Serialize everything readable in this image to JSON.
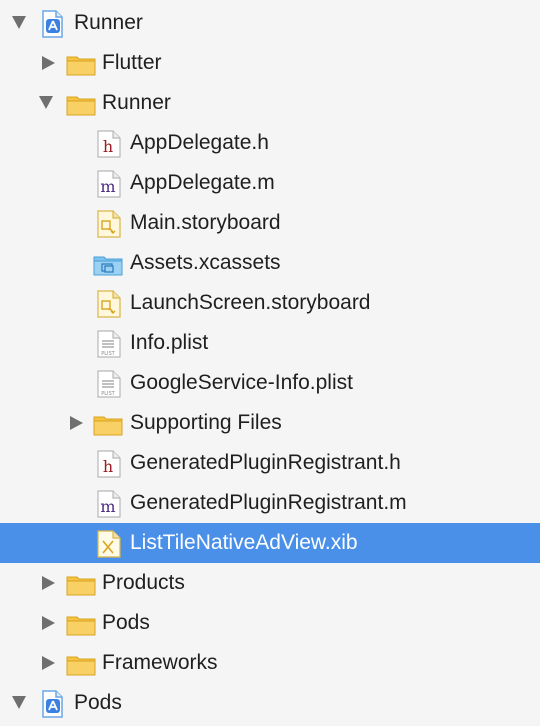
{
  "colors": {
    "background": "#f5f5f5",
    "selection": "#4a90e8",
    "folder": "#f5c242",
    "folder_blue": "#7cc3f0",
    "header_file": "#9b1c22",
    "impl_file": "#4b2a83"
  },
  "tree": [
    {
      "label": "Runner",
      "icon": "xcode-project-icon",
      "disclosure": "expanded"
    },
    {
      "label": "Flutter",
      "icon": "folder-icon",
      "disclosure": "collapsed"
    },
    {
      "label": "Runner",
      "icon": "folder-icon",
      "disclosure": "expanded"
    },
    {
      "label": "AppDelegate.h",
      "icon": "header-file-icon",
      "icon_glyph": "h"
    },
    {
      "label": "AppDelegate.m",
      "icon": "implementation-file-icon",
      "icon_glyph": "m"
    },
    {
      "label": "Main.storyboard",
      "icon": "storyboard-file-icon"
    },
    {
      "label": "Assets.xcassets",
      "icon": "asset-catalog-icon"
    },
    {
      "label": "LaunchScreen.storyboard",
      "icon": "storyboard-file-icon"
    },
    {
      "label": "Info.plist",
      "icon": "plist-file-icon",
      "icon_glyph": "PLIST"
    },
    {
      "label": "GoogleService-Info.plist",
      "icon": "plist-file-icon",
      "icon_glyph": "PLIST"
    },
    {
      "label": "Supporting Files",
      "icon": "folder-icon",
      "disclosure": "collapsed"
    },
    {
      "label": "GeneratedPluginRegistrant.h",
      "icon": "header-file-icon",
      "icon_glyph": "h"
    },
    {
      "label": "GeneratedPluginRegistrant.m",
      "icon": "implementation-file-icon",
      "icon_glyph": "m"
    },
    {
      "label": "ListTileNativeAdView.xib",
      "icon": "xib-file-icon",
      "selected": true
    },
    {
      "label": "Products",
      "icon": "folder-icon",
      "disclosure": "collapsed"
    },
    {
      "label": "Pods",
      "icon": "folder-icon",
      "disclosure": "collapsed"
    },
    {
      "label": "Frameworks",
      "icon": "folder-icon",
      "disclosure": "collapsed"
    },
    {
      "label": "Pods",
      "icon": "xcode-project-icon",
      "disclosure": "expanded"
    }
  ]
}
